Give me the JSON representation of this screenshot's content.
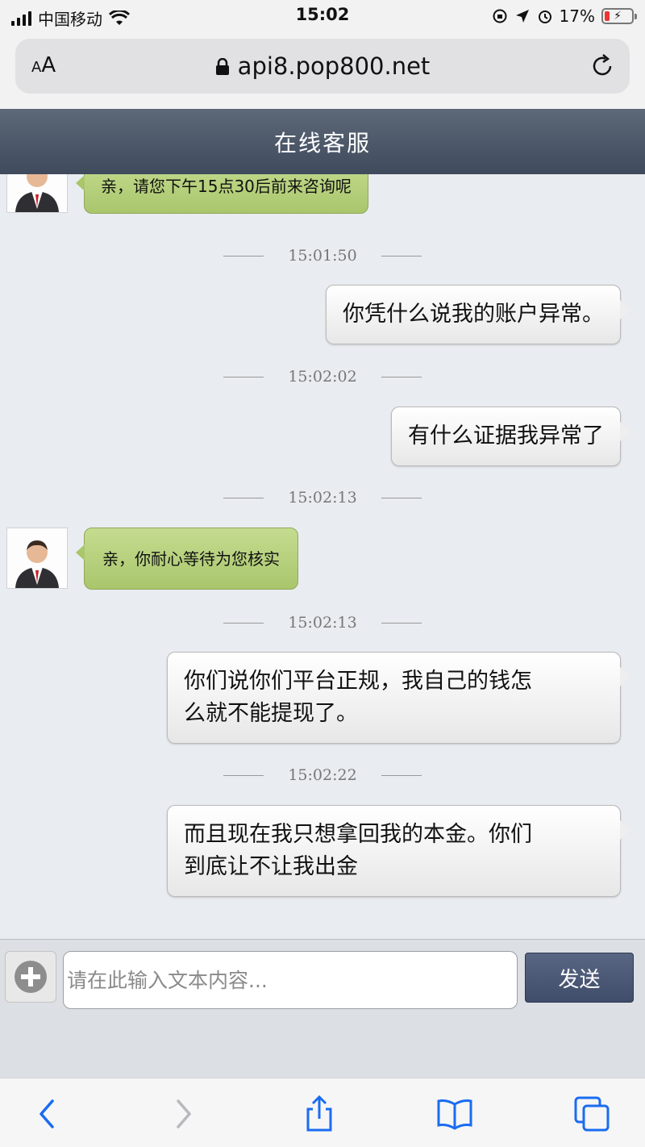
{
  "status_bar": {
    "carrier": "中国移动",
    "time": "15:02",
    "battery": "17%",
    "battery_level": 0.17
  },
  "browser": {
    "text_size_label": "AA",
    "url": "api8.pop800.net"
  },
  "header": {
    "title": "在线客服"
  },
  "chat": {
    "messages": [
      {
        "from": "agent",
        "text": "亲，请您下午15点30后前来咨询呢"
      },
      {
        "type": "timestamp",
        "text": "15:01:50"
      },
      {
        "from": "user",
        "text": "你凭什么说我的账户异常。"
      },
      {
        "type": "timestamp",
        "text": "15:02:02"
      },
      {
        "from": "user",
        "text": "有什么证据我异常了"
      },
      {
        "type": "timestamp",
        "text": "15:02:13"
      },
      {
        "from": "agent",
        "text": "亲，你耐心等待为您核实"
      },
      {
        "type": "timestamp",
        "text": "15:02:13"
      },
      {
        "from": "user",
        "lines": [
          "你们说你们平台正规，我自己的钱怎",
          "么就不能提现了。"
        ]
      },
      {
        "type": "timestamp",
        "text": "15:02:22"
      },
      {
        "from": "user",
        "lines": [
          "而且现在我只想拿回我的本金。你们",
          "到底让不让我出金"
        ]
      }
    ]
  },
  "composer": {
    "placeholder": "请在此输入文本内容...",
    "value": "",
    "send_label": "发送"
  },
  "toolbar": {
    "icons": [
      "back-icon",
      "forward-icon",
      "share-icon",
      "bookmarks-icon",
      "tabs-icon"
    ]
  }
}
